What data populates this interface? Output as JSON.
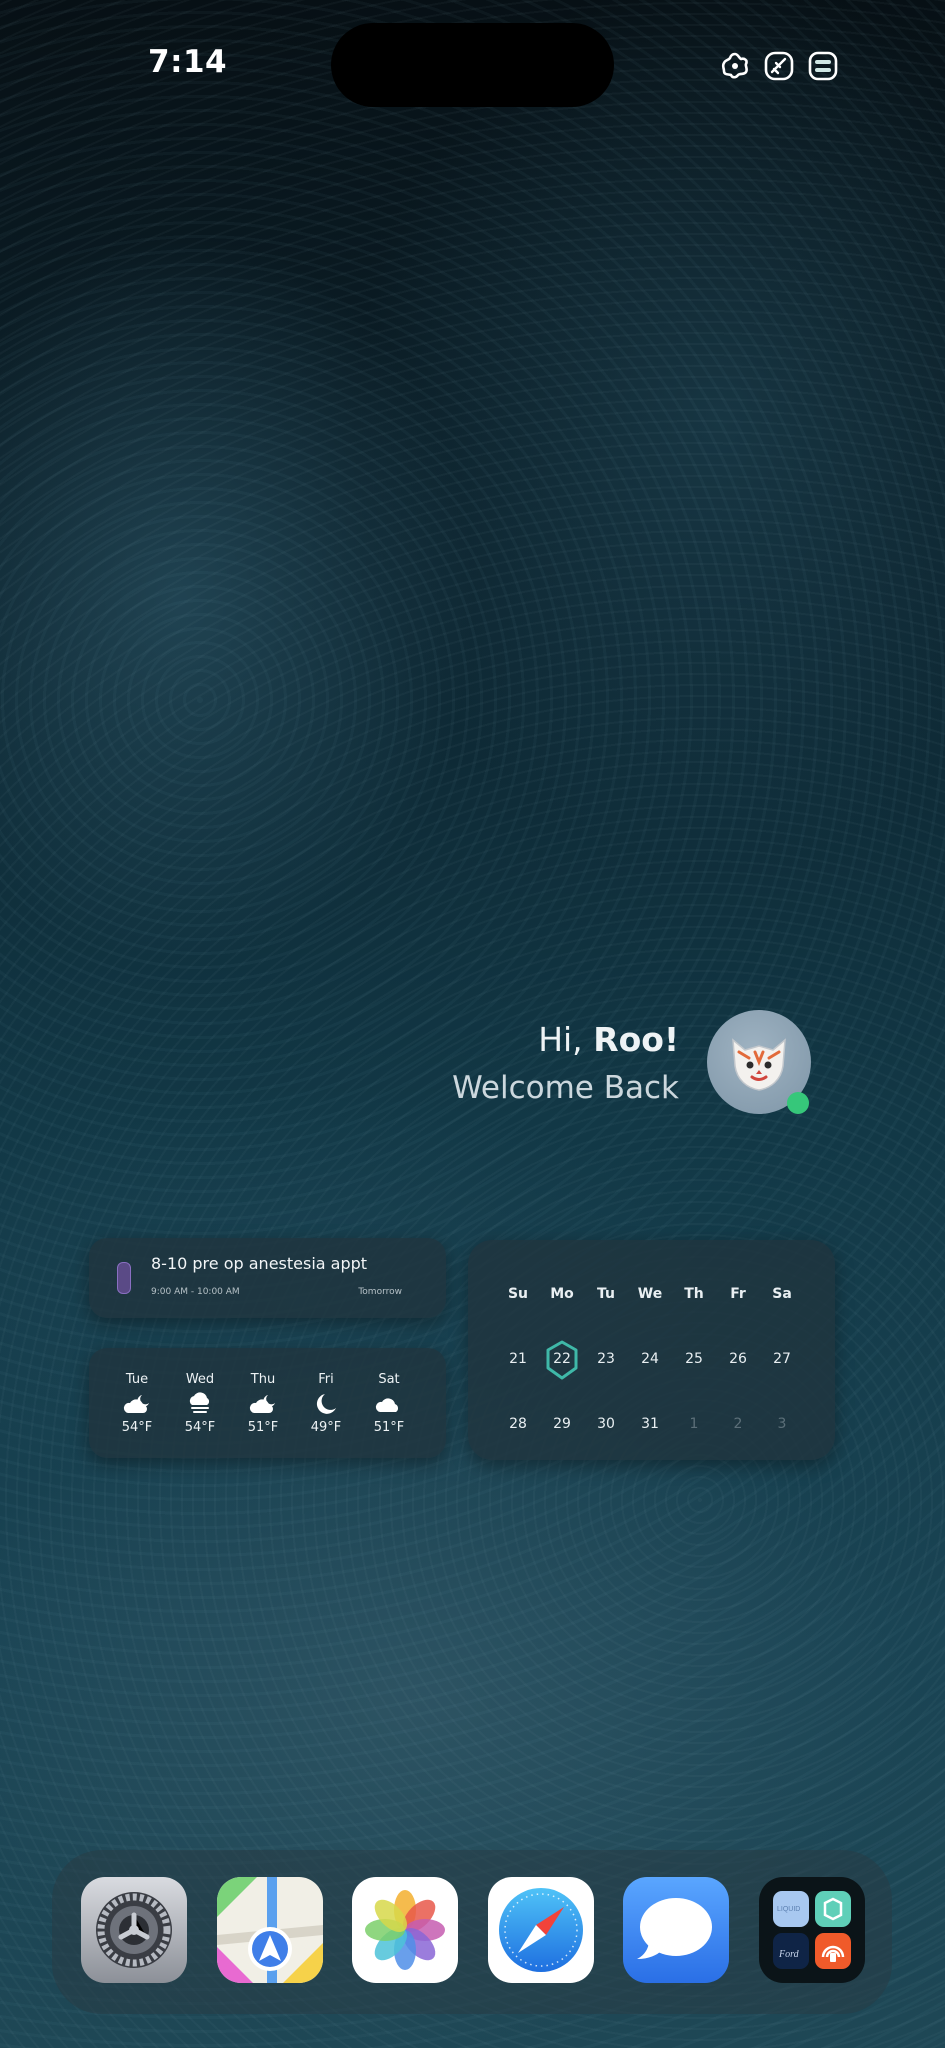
{
  "status_bar": {
    "time": "7:14"
  },
  "greeting": {
    "hi": "Hi,",
    "name": "Roo!",
    "welcome": "Welcome Back"
  },
  "event": {
    "title": "8-10 pre op anestesia appt",
    "time": "9:00 AM - 10:00 AM",
    "when": "Tomorrow",
    "color": "#5a4a86"
  },
  "weather": {
    "days": [
      {
        "day": "Tue",
        "icon": "partly-cloudy-night-icon",
        "temp": "54°F"
      },
      {
        "day": "Wed",
        "icon": "fog-icon",
        "temp": "54°F"
      },
      {
        "day": "Thu",
        "icon": "partly-cloudy-night-icon",
        "temp": "51°F"
      },
      {
        "day": "Fri",
        "icon": "moon-icon",
        "temp": "49°F"
      },
      {
        "day": "Sat",
        "icon": "cloud-icon",
        "temp": "51°F"
      }
    ]
  },
  "calendar": {
    "weekdays": [
      "Su",
      "Mo",
      "Tu",
      "We",
      "Th",
      "Fr",
      "Sa"
    ],
    "weeks": [
      [
        "21",
        "22",
        "23",
        "24",
        "25",
        "26",
        "27"
      ],
      [
        "28",
        "29",
        "30",
        "31",
        "1",
        "2",
        "3"
      ]
    ],
    "today": "22",
    "accent": "#3fb8a8"
  },
  "dock": {
    "apps": [
      "settings-app-icon",
      "maps-app-icon",
      "photos-app-icon",
      "safari-app-icon",
      "messages-app-icon",
      "app-folder-icon"
    ],
    "folder_labels": {
      "ford": "Ford",
      "top_left": "LIQUID"
    }
  }
}
